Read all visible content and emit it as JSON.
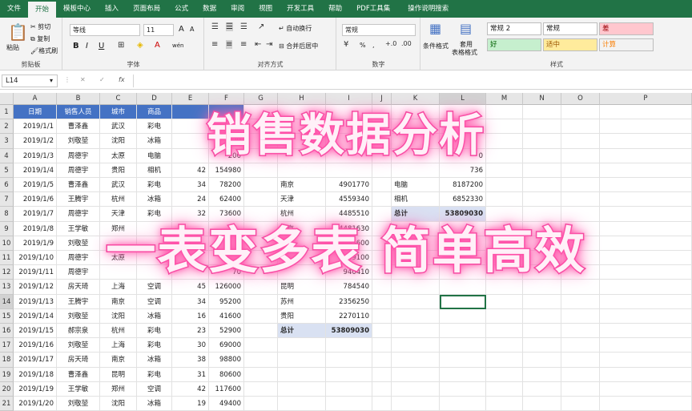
{
  "tabs": [
    "文件",
    "开始",
    "模板中心",
    "插入",
    "页面布局",
    "公式",
    "数据",
    "审阅",
    "视图",
    "开发工具",
    "帮助",
    "PDF工具集",
    "操作说明搜索"
  ],
  "active_tab": "开始",
  "ribbon": {
    "clipboard": {
      "paste": "粘贴",
      "cut": "剪切",
      "copy": "复制",
      "format_painter": "格式刷",
      "label": "剪贴板"
    },
    "font": {
      "name": "等线",
      "size": "11",
      "bold": "B",
      "italic": "I",
      "underline": "U",
      "label": "字体",
      "grow": "A",
      "shrink": "A",
      "wen": "wén"
    },
    "alignment": {
      "wrap": "自动换行",
      "merge": "合并后居中",
      "label": "对齐方式"
    },
    "number": {
      "format": "常规",
      "label": "数字",
      "percent": "%",
      "comma": ","
    },
    "styles": {
      "cond": "条件格式",
      "table": "套用",
      "table2": "表格格式",
      "label": "样式",
      "boxes": [
        {
          "text": "常规 2",
          "bg": "#ffffff",
          "fg": "#222222"
        },
        {
          "text": "常规",
          "bg": "#ffffff",
          "fg": "#222222"
        },
        {
          "text": "差",
          "bg": "#ffc7ce",
          "fg": "#9c0006"
        },
        {
          "text": "好",
          "bg": "#c6efce",
          "fg": "#006100"
        },
        {
          "text": "适中",
          "bg": "#ffeb9c",
          "fg": "#9c5700"
        },
        {
          "text": "计算",
          "bg": "#f2f2f2",
          "fg": "#fa7d00"
        }
      ]
    }
  },
  "formula_bar": {
    "namebox": "L14",
    "fx": "fx",
    "cancel": "✕",
    "enter": "✓"
  },
  "columns": [
    "A",
    "B",
    "C",
    "D",
    "E",
    "F",
    "G",
    "H",
    "I",
    "J",
    "K",
    "L",
    "M",
    "N",
    "O",
    "P"
  ],
  "rows": [
    "1",
    "2",
    "3",
    "4",
    "5",
    "6",
    "7",
    "8",
    "9",
    "10",
    "11",
    "12",
    "13",
    "14",
    "15",
    "16",
    "17",
    "18",
    "19",
    "20",
    "21"
  ],
  "table1": {
    "headers": [
      "日期",
      "销售人员",
      "城市",
      "商品",
      "",
      ""
    ],
    "rows": [
      [
        "2019/1/1",
        "曹泽鑫",
        "武汉",
        "彩电",
        "",
        "20"
      ],
      [
        "2019/1/2",
        "刘敬堃",
        "沈阳",
        "冰箱",
        "",
        "020"
      ],
      [
        "2019/1/3",
        "周德宇",
        "太原",
        "电脑",
        "",
        "200"
      ],
      [
        "2019/1/4",
        "周德宇",
        "贵阳",
        "相机",
        "42",
        "154980"
      ],
      [
        "2019/1/5",
        "曹泽鑫",
        "武汉",
        "彩电",
        "34",
        "78200"
      ],
      [
        "2019/1/6",
        "王腾宇",
        "杭州",
        "冰箱",
        "24",
        "62400"
      ],
      [
        "2019/1/7",
        "周德宇",
        "天津",
        "彩电",
        "32",
        "73600"
      ],
      [
        "2019/1/8",
        "王学敏",
        "郑州",
        "",
        "",
        ""
      ],
      [
        "2019/1/9",
        "刘敬堃",
        "",
        "",
        "",
        ""
      ],
      [
        "2019/1/10",
        "周德宇",
        "太原",
        "",
        "",
        ""
      ],
      [
        "2019/1/11",
        "周德宇",
        "",
        "",
        "",
        "70"
      ],
      [
        "2019/1/12",
        "房天琦",
        "上海",
        "空调",
        "45",
        "126000"
      ],
      [
        "2019/1/13",
        "王腾宇",
        "南京",
        "空调",
        "34",
        "95200"
      ],
      [
        "2019/1/14",
        "刘敬堃",
        "沈阳",
        "冰箱",
        "16",
        "41600"
      ],
      [
        "2019/1/15",
        "郝宗泉",
        "杭州",
        "彩电",
        "23",
        "52900"
      ],
      [
        "2019/1/16",
        "刘敬堃",
        "上海",
        "彩电",
        "30",
        "69000"
      ],
      [
        "2019/1/17",
        "房天琦",
        "南京",
        "冰箱",
        "38",
        "98800"
      ],
      [
        "2019/1/18",
        "曹泽鑫",
        "昆明",
        "彩电",
        "31",
        "80600"
      ],
      [
        "2019/1/19",
        "王学敏",
        "郑州",
        "空调",
        "42",
        "117600"
      ],
      [
        "2019/1/20",
        "刘敬堃",
        "沈阳",
        "冰箱",
        "19",
        "49400"
      ]
    ]
  },
  "table2": {
    "rows": [
      [
        "",
        ""
      ],
      [
        "",
        ""
      ],
      [
        "",
        ""
      ],
      [
        "",
        ""
      ],
      [
        "南京",
        "4901770"
      ],
      [
        "天津",
        "4559340"
      ],
      [
        "杭州",
        "4485510"
      ],
      [
        "北京",
        "4481630"
      ],
      [
        "",
        "35600"
      ],
      [
        "",
        "049100"
      ],
      [
        "",
        "940410"
      ],
      [
        "昆明",
        "784540"
      ],
      [
        "苏州",
        "2356250"
      ],
      [
        "贵阳",
        "2270110"
      ]
    ],
    "total": [
      "总计",
      "53809030"
    ]
  },
  "table3": {
    "rows": [
      [
        "",
        ""
      ],
      [
        "",
        ""
      ],
      [
        "",
        "0"
      ],
      [
        "",
        "736"
      ],
      [
        "电脑",
        "8187200"
      ],
      [
        "相机",
        "6852330"
      ]
    ],
    "total": [
      "总计",
      "53809030"
    ]
  },
  "overlay": {
    "line1": "销售数据分析",
    "line2": "一表变多表 简单高效"
  }
}
